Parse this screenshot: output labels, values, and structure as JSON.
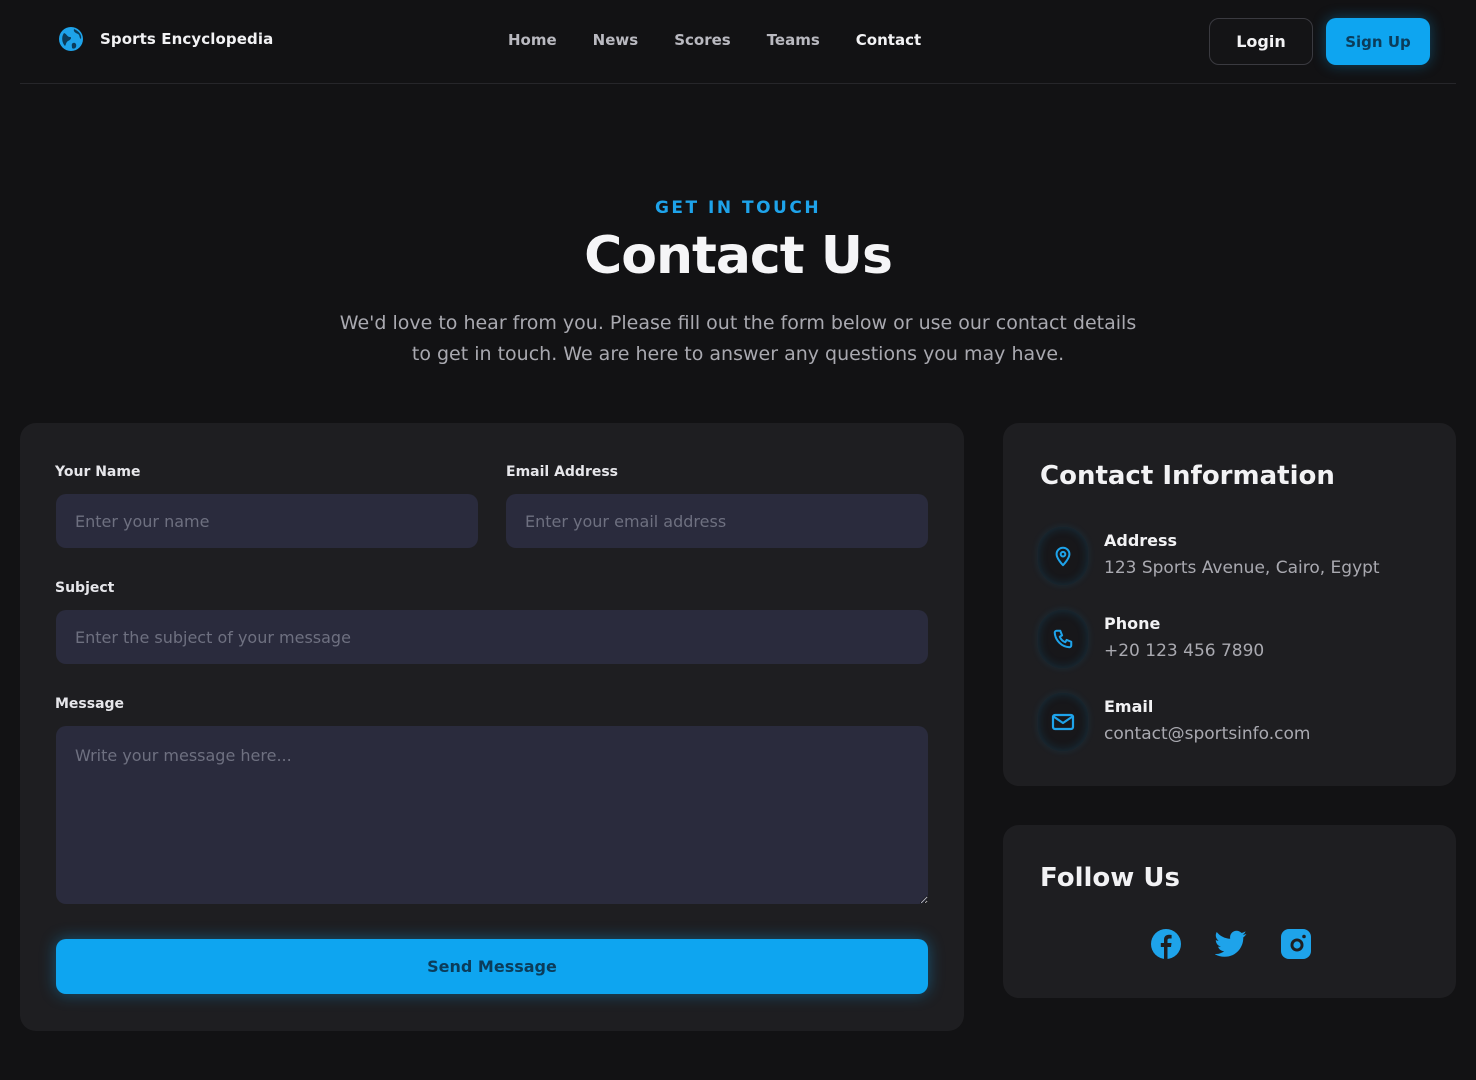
{
  "brand": {
    "name": "Sports Encyclopedia",
    "icon": "globe-icon"
  },
  "nav": {
    "items": [
      {
        "label": "Home"
      },
      {
        "label": "News"
      },
      {
        "label": "Scores"
      },
      {
        "label": "Teams"
      },
      {
        "label": "Contact",
        "active": true
      }
    ]
  },
  "auth": {
    "login_label": "Login",
    "signup_label": "Sign Up"
  },
  "hero": {
    "eyebrow": "GET IN TOUCH",
    "title": "Contact Us",
    "intro": "We'd love to hear from you. Please fill out the form below or use our contact details to get in touch. We are here to answer any questions you may have."
  },
  "form": {
    "name": {
      "label": "Your Name",
      "placeholder": "Enter your name",
      "value": ""
    },
    "email": {
      "label": "Email Address",
      "placeholder": "Enter your email address",
      "value": ""
    },
    "subject": {
      "label": "Subject",
      "placeholder": "Enter the subject of your message",
      "value": ""
    },
    "message": {
      "label": "Message",
      "placeholder": "Write your message here...",
      "value": ""
    },
    "submit_label": "Send Message"
  },
  "contact_info": {
    "title": "Contact Information",
    "items": [
      {
        "label": "Address",
        "value": "123 Sports Avenue, Cairo, Egypt",
        "icon": "map-pin-icon"
      },
      {
        "label": "Phone",
        "value": "+20 123 456 7890",
        "icon": "phone-icon"
      },
      {
        "label": "Email",
        "value": "contact@sportsinfo.com",
        "icon": "mail-icon"
      }
    ]
  },
  "follow": {
    "title": "Follow Us",
    "links": [
      {
        "name": "facebook-icon"
      },
      {
        "name": "twitter-icon"
      },
      {
        "name": "instagram-icon"
      }
    ]
  },
  "colors": {
    "background": "#121214",
    "card": "#1e1e21",
    "input": "#2a2b3d",
    "accent": "#0ea5f0",
    "eyebrow": "#1ea3ea"
  }
}
